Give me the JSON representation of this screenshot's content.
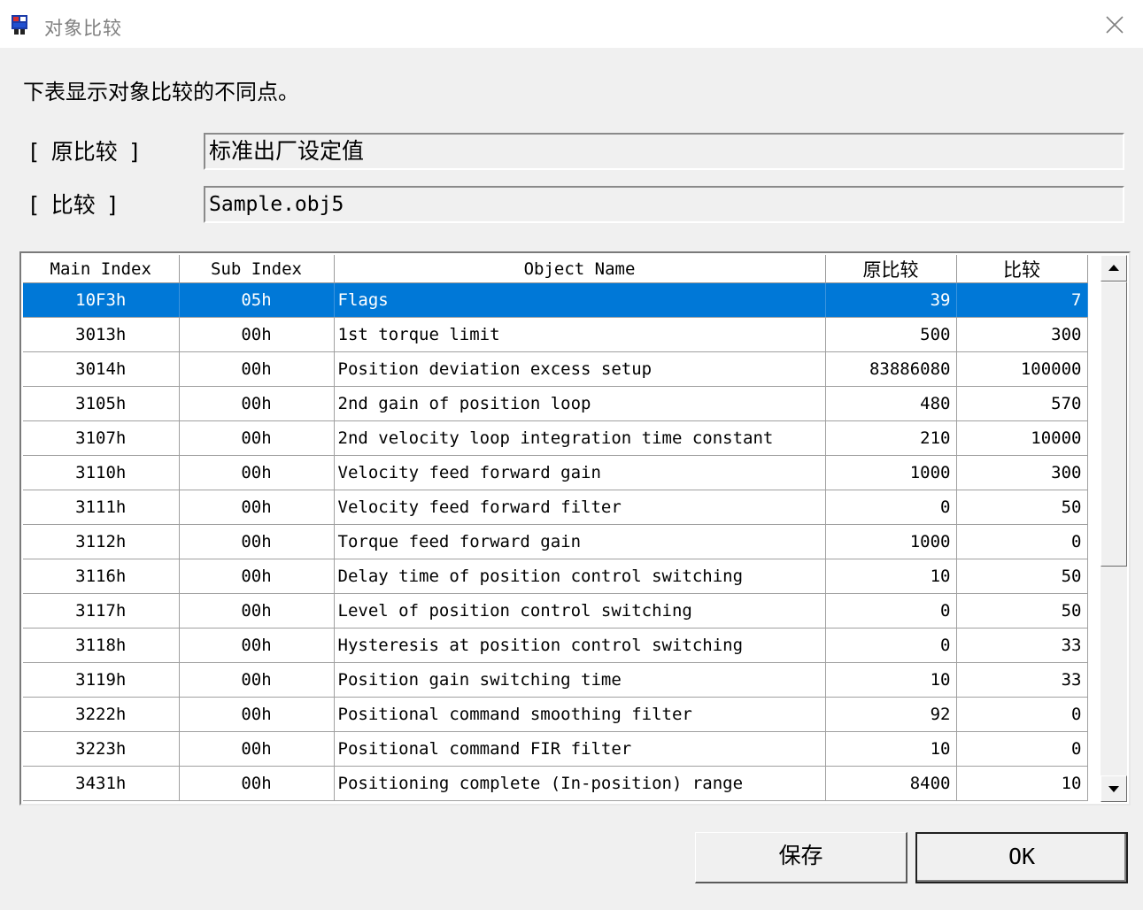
{
  "window": {
    "title": "对象比较"
  },
  "description": "下表显示对象比较的不同点。",
  "original": {
    "label": "[ 原比较 ]",
    "value": "标准出厂设定值"
  },
  "compare": {
    "label": "[ 比较 ]",
    "value": "Sample.obj5"
  },
  "table": {
    "headers": [
      "Main Index",
      "Sub Index",
      "Object Name",
      "原比较",
      "比较"
    ],
    "selected_row": 0,
    "rows": [
      [
        "10F3h",
        "05h",
        "Flags",
        "39",
        "7"
      ],
      [
        "3013h",
        "00h",
        "1st torque limit",
        "500",
        "300"
      ],
      [
        "3014h",
        "00h",
        "Position deviation excess setup",
        "83886080",
        "100000"
      ],
      [
        "3105h",
        "00h",
        "2nd gain of position loop",
        "480",
        "570"
      ],
      [
        "3107h",
        "00h",
        "2nd velocity loop integration time constant",
        "210",
        "10000"
      ],
      [
        "3110h",
        "00h",
        "Velocity feed forward gain",
        "1000",
        "300"
      ],
      [
        "3111h",
        "00h",
        "Velocity feed forward filter",
        "0",
        "50"
      ],
      [
        "3112h",
        "00h",
        "Torque feed forward gain",
        "1000",
        "0"
      ],
      [
        "3116h",
        "00h",
        "Delay time of position control switching",
        "10",
        "50"
      ],
      [
        "3117h",
        "00h",
        "Level of position control switching",
        "0",
        "50"
      ],
      [
        "3118h",
        "00h",
        "Hysteresis at position control switching",
        "0",
        "33"
      ],
      [
        "3119h",
        "00h",
        "Position gain switching time",
        "10",
        "33"
      ],
      [
        "3222h",
        "00h",
        "Positional command smoothing filter",
        "92",
        "0"
      ],
      [
        "3223h",
        "00h",
        "Positional command FIR filter",
        "10",
        "0"
      ],
      [
        "3431h",
        "00h",
        "Positioning complete (In-position) range",
        "8400",
        "10"
      ]
    ]
  },
  "buttons": {
    "save": "保存",
    "ok": "OK"
  },
  "colors": {
    "selection": "#0078d7",
    "background": "#f0f0f0"
  },
  "icons": {
    "app": "app-window-icon",
    "close": "close-icon",
    "scroll_up": "arrow-up-icon",
    "scroll_down": "arrow-down-icon"
  }
}
